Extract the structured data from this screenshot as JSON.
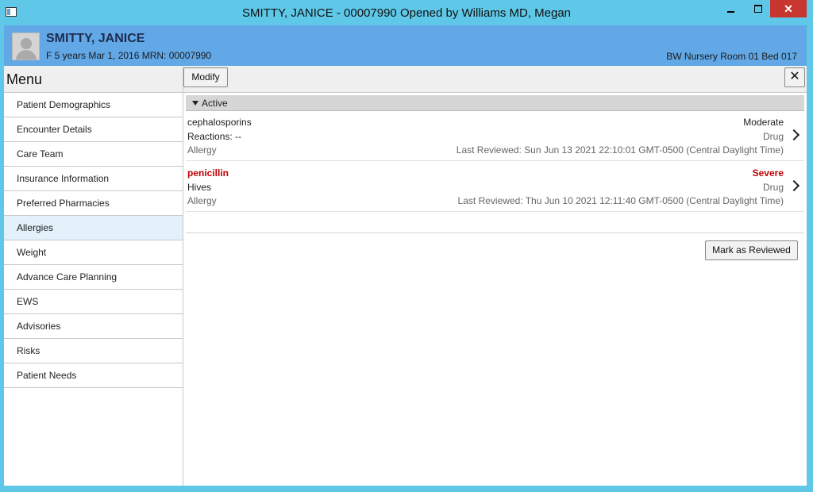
{
  "window": {
    "title": "SMITTY, JANICE - 00007990 Opened by Williams MD, Megan",
    "close_glyph": "✕"
  },
  "patient": {
    "name": "SMITTY, JANICE",
    "info": "F 5 years Mar 1, 2016 MRN: 00007990",
    "location": "BW Nursery Room 01 Bed 017"
  },
  "menu": {
    "header": "Menu",
    "items": [
      {
        "label": "Patient Demographics"
      },
      {
        "label": "Encounter Details"
      },
      {
        "label": "Care Team"
      },
      {
        "label": "Insurance Information"
      },
      {
        "label": "Preferred Pharmacies"
      },
      {
        "label": "Allergies",
        "selected": true
      },
      {
        "label": "Weight"
      },
      {
        "label": "Advance Care Planning"
      },
      {
        "label": "EWS"
      },
      {
        "label": "Advisories"
      },
      {
        "label": "Risks"
      },
      {
        "label": "Patient Needs"
      }
    ]
  },
  "toolbar": {
    "modify_label": "Modify",
    "close_glyph": "✕"
  },
  "allergies": {
    "section_label": "Active",
    "items": [
      {
        "name": "cephalosporins",
        "reaction": "Reactions: --",
        "category": "Allergy",
        "severity": "Moderate",
        "type": "Drug",
        "reviewed": "Last Reviewed: Sun Jun 13 2021 22:10:01 GMT-0500 (Central Daylight Time)"
      },
      {
        "name": "penicillin",
        "reaction": "Hives",
        "category": "Allergy",
        "severity": "Severe",
        "type": "Drug",
        "reviewed": "Last Reviewed: Thu Jun 10 2021 12:11:40 GMT-0500 (Central Daylight Time)"
      }
    ],
    "mark_reviewed_label": "Mark as Reviewed"
  },
  "colors": {
    "titlebar": "#5fc8e8",
    "banner": "#62a8e6",
    "severe": "#c00000",
    "selected_menu": "#e3f1fa"
  }
}
